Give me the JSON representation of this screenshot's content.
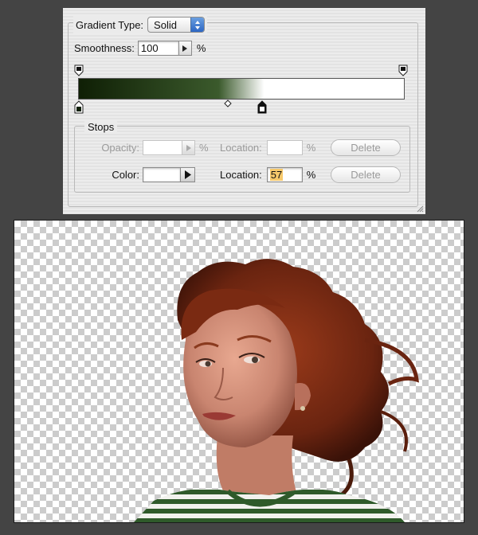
{
  "gradient_editor": {
    "gradient_type_label": "Gradient Type:",
    "gradient_type_value": "Solid",
    "smoothness_label": "Smoothness:",
    "smoothness_value": "100",
    "smoothness_unit": "%",
    "gradient_colors": [
      "#0f1f05",
      "#3b5a2c",
      "#ffffff",
      "#ffffff"
    ],
    "color_stop_locations": [
      0,
      57
    ],
    "opacity_stop_locations": [
      0,
      100
    ],
    "midpoint_location": 46
  },
  "stops": {
    "title": "Stops",
    "opacity_label": "Opacity:",
    "opacity_value": "",
    "opacity_unit": "%",
    "opacity_location_label": "Location:",
    "opacity_location_value": "",
    "opacity_location_unit": "%",
    "opacity_delete_label": "Delete",
    "color_label": "Color:",
    "color_swatch": "#ffffff",
    "color_location_label": "Location:",
    "color_location_value": "57",
    "color_location_unit": "%",
    "color_delete_label": "Delete"
  },
  "canvas": {
    "background": "transparent-checkerboard",
    "subject": "portrait of a red curly-haired woman in a green and white striped top, cut out on a transparent background",
    "hair_color": "#7a2a12",
    "shirt_colors": [
      "#2f5a2a",
      "#f2f2ee"
    ]
  }
}
